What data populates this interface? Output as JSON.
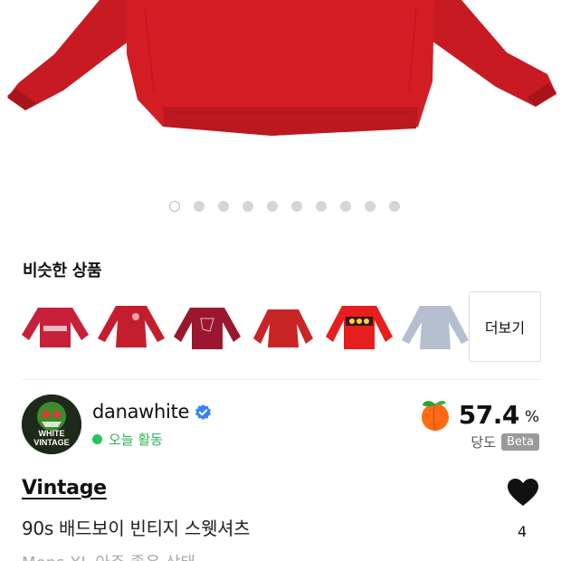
{
  "gallery": {
    "total_images": 10,
    "active_index": 0
  },
  "similar": {
    "title": "비슷한 상품",
    "more_label": "더보기",
    "items": [
      {
        "color": "#c8203a"
      },
      {
        "color": "#c41e2e"
      },
      {
        "color": "#9b1730"
      },
      {
        "color": "#c92525"
      },
      {
        "color": "#e61e1e"
      },
      {
        "color": "#b6bfce"
      }
    ]
  },
  "seller": {
    "name": "danawhite",
    "activity": "오늘 활동",
    "avatar_text_1": "WHITE",
    "avatar_text_2": "VINTAGE",
    "score": "57.4",
    "score_unit": "%",
    "score_label": "당도",
    "beta_label": "Beta"
  },
  "product": {
    "brand": "Vintage",
    "title": "90s 배드보이 빈티지 스웻셔츠",
    "subtitle": "Mens XL 아주 좋은 상태",
    "likes": "4"
  },
  "colors": {
    "accent_green": "#22c55e",
    "sweater_red": "#d41c24",
    "verified_blue": "#3b82f6"
  }
}
